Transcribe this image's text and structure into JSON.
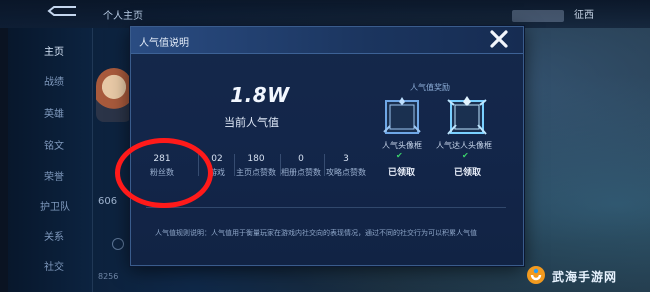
{
  "background": {
    "top_title": "个人主页",
    "top_right_name": "征西",
    "sidebar": {
      "items": [
        {
          "label": "主页",
          "active": true
        },
        {
          "label": "战绩"
        },
        {
          "label": "英雄"
        },
        {
          "label": "铭文"
        },
        {
          "label": "荣誉"
        },
        {
          "label": "护卫队"
        },
        {
          "label": "关系"
        },
        {
          "label": "社交"
        }
      ]
    },
    "partial_number": "606",
    "partial_small": "8256"
  },
  "modal": {
    "title": "人气值说明",
    "close_icon": "close-icon",
    "popularity_value": "1.8W",
    "popularity_label": "当前人气值",
    "rewards": {
      "heading": "人气值奖励",
      "items": [
        {
          "label": "人气头像框",
          "status": "已领取"
        },
        {
          "label": "人气达人头像框",
          "status": "已领取"
        }
      ]
    },
    "stats": [
      {
        "value": "281",
        "label": "粉丝数"
      },
      {
        "value": "02",
        "label": "游戏"
      },
      {
        "value": "180",
        "label": "主页点赞数"
      },
      {
        "value": "0",
        "label": "相册点赞数"
      },
      {
        "value": "3",
        "label": "攻略点赞数"
      }
    ],
    "description": "人气值规则说明：人气值用于衡量玩家在游戏内社交向的表现情况，通过不同的社交行为可以积累人气值"
  },
  "annotation": {
    "color": "#ff1a1a"
  },
  "watermark": {
    "text": "武海手游网"
  },
  "colors": {
    "accent": "#3a5c8c",
    "check_green": "#3bd36b",
    "annotation_red": "#ff1a1a"
  }
}
